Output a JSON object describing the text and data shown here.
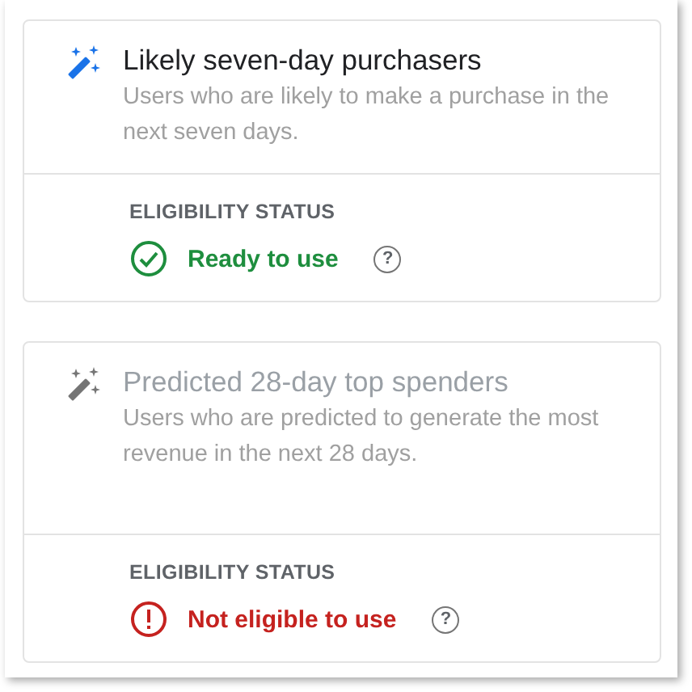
{
  "audiences": [
    {
      "title": "Likely seven-day purchasers",
      "description": "Users who are likely to make a purchase in the next seven days.",
      "disabled": false,
      "status_label": "ELIGIBILITY STATUS",
      "status": {
        "kind": "ready",
        "text": "Ready to use",
        "help": "?"
      }
    },
    {
      "title": "Predicted 28-day top spenders",
      "description": "Users who are predicted to generate the most revenue in the next 28 days.",
      "disabled": true,
      "status_label": "ELIGIBILITY STATUS",
      "status": {
        "kind": "not_eligible",
        "text": "Not eligible to use",
        "help": "?"
      }
    }
  ]
}
